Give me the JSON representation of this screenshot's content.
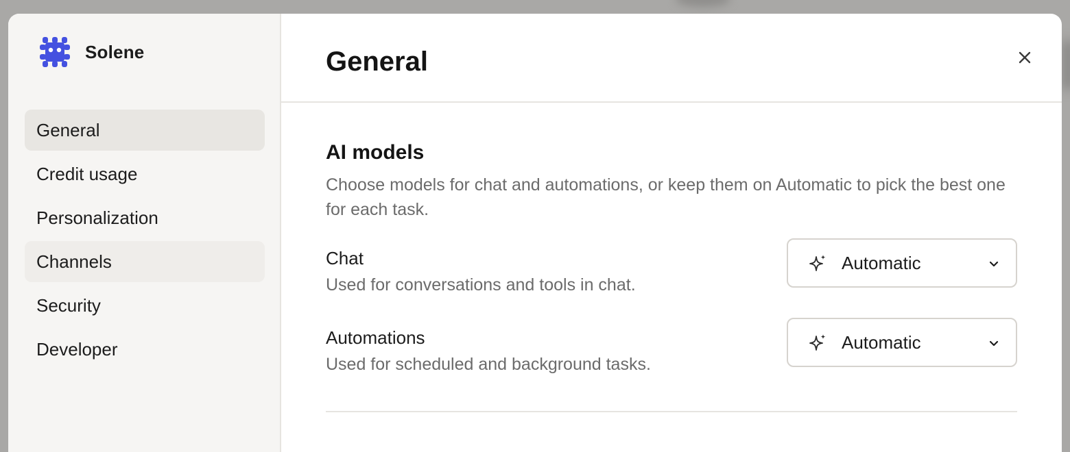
{
  "app": {
    "name": "Solene",
    "logo_icon": "puzzle-gear-icon",
    "brand_color": "#4451e0"
  },
  "sidebar": {
    "items": [
      {
        "label": "General",
        "state": "active"
      },
      {
        "label": "Credit usage",
        "state": "normal"
      },
      {
        "label": "Personalization",
        "state": "normal"
      },
      {
        "label": "Channels",
        "state": "hover"
      },
      {
        "label": "Security",
        "state": "normal"
      },
      {
        "label": "Developer",
        "state": "normal"
      }
    ]
  },
  "header": {
    "title": "General",
    "close_icon": "close-icon"
  },
  "ai_models": {
    "title": "AI models",
    "description": "Choose models for chat and automations, or keep them on Automatic to pick the best one for each task.",
    "chat": {
      "label": "Chat",
      "help": "Used for conversations and tools in chat.",
      "selected": "Automatic",
      "icon": "sparkle-icon"
    },
    "automations": {
      "label": "Automations",
      "help": "Used for scheduled and background tasks.",
      "selected": "Automatic",
      "icon": "sparkle-icon"
    }
  }
}
